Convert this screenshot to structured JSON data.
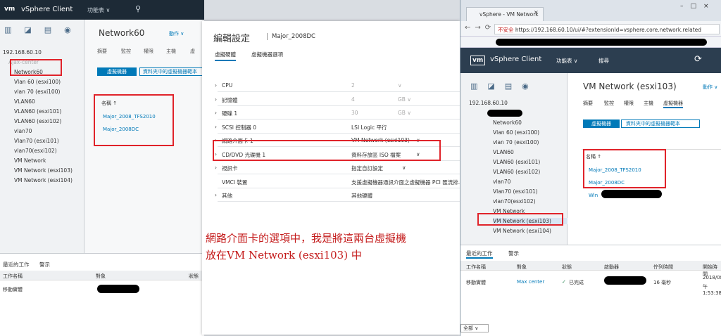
{
  "left": {
    "header": {
      "logo": "vm",
      "title": "vSphere Client",
      "menu": "功能表 ∨",
      "search_icon": "search-icon"
    },
    "tree": [
      "192.168.60.10",
      "Ajax-center",
      "Network60",
      "Vlan 60 (esxi100)",
      "vlan 70 (esxi100)",
      "VLAN60",
      "VLAN60 (esxi101)",
      "VLAN60 (esxi102)",
      "vlan70",
      "Vlan70 (esxi101)",
      "vlan70(esxi102)",
      "VM Network",
      "VM Network (esxi103)",
      "VM Network (esxi104)"
    ],
    "main": {
      "title": "Network60",
      "actions": "動作 ∨",
      "tabs": [
        "摘要",
        "監控",
        "權限",
        "主機",
        "虛"
      ],
      "subtab_active": "虛擬機器",
      "subtab_other": "資料夾中的虛擬機器範本",
      "col_name": "名稱 ↑",
      "vms": [
        "Major_2008_TFS2010",
        "Major_2008DC"
      ]
    },
    "bottom": {
      "tab_recent": "最近的工作",
      "tab_alarm": "警示",
      "col_task": "工作名稱",
      "col_target": "對象",
      "col_status": "狀態",
      "task": "移動實體"
    }
  },
  "dialog": {
    "title": "編輯設定",
    "vm_name": "Major_2008DC",
    "tabs": [
      "虛擬硬體",
      "虛擬機器選項"
    ],
    "rows": [
      {
        "label": "CPU",
        "value": "2",
        "unit": "∨"
      },
      {
        "label": "記憶體",
        "value": "4",
        "unit": "GB ∨"
      },
      {
        "label": "硬碟 1",
        "value": "30",
        "unit": "GB ∨"
      },
      {
        "label": "SCSI 控制器 0",
        "value": "LSI Logic 平行",
        "unit": ""
      },
      {
        "label": "網路介面卡 1",
        "value": "VM Network (esxi103)",
        "unit": "∨"
      },
      {
        "label": "CD/DVD 光碟機 1",
        "value": "資料存放區 ISO 檔案",
        "unit": "∨"
      },
      {
        "label": "視訊卡",
        "value": "指定自訂設定",
        "unit": "∨"
      },
      {
        "label": "VMCI 裝置",
        "value": "支援虛擬機器通訊介面之虛擬機器 PCI 匯流排...",
        "unit": ""
      },
      {
        "label": "其他",
        "value": "其他硬體",
        "unit": ""
      }
    ],
    "note_line1": "網路介面卡的選項中，我是將這兩台虛擬機",
    "note_line2": "放在VM Network (esxi103) 中"
  },
  "browser": {
    "tab_title": "vSphere - VM Network",
    "address": {
      "insecure": "不安全",
      "url": "https://192.168.60.10/ui/#?extensionId=vsphere.core.network.related"
    },
    "header": {
      "logo": "vm",
      "title": "vSphere Client",
      "menu": "功能表 ∨",
      "search": "搜尋"
    },
    "tree": [
      "192.168.60.10",
      "Network60",
      "Vlan 60 (esxi100)",
      "vlan 70 (esxi100)",
      "VLAN60",
      "VLAN60 (esxi101)",
      "VLAN60 (esxi102)",
      "vlan70",
      "Vlan70 (esxi101)",
      "vlan70(esxi102)",
      "VM Network",
      "VM Network (esxi103)",
      "VM Network (esxi104)"
    ],
    "main": {
      "title": "VM Network (esxi103)",
      "actions": "動作 ∨",
      "tabs": [
        "摘要",
        "監控",
        "權限",
        "主機",
        "虛擬機器"
      ],
      "subtab_active": "虛擬機器",
      "subtab_other": "資料夾中的虛擬機器範本",
      "col_name": "名稱 ↑",
      "vms": [
        "Major_2008_TFS2010",
        "Major_2008DC",
        "Win"
      ]
    },
    "bottom": {
      "tab_recent": "最近的工作",
      "tab_alarm": "警示",
      "cols": [
        "工作名稱",
        "對象",
        "狀態",
        "啟動器",
        "佇列時間",
        "開始時間"
      ],
      "task": "移動實體",
      "target": "Max center",
      "status": "已完成",
      "queue": "16 毫秒",
      "start1": "2018/08/",
      "start2": "午1:53:38",
      "filter": "全部 ∨"
    }
  },
  "colors": {
    "accent": "#0079b8",
    "header_dark": "#1d2a36",
    "annotation": "#e0232a"
  }
}
